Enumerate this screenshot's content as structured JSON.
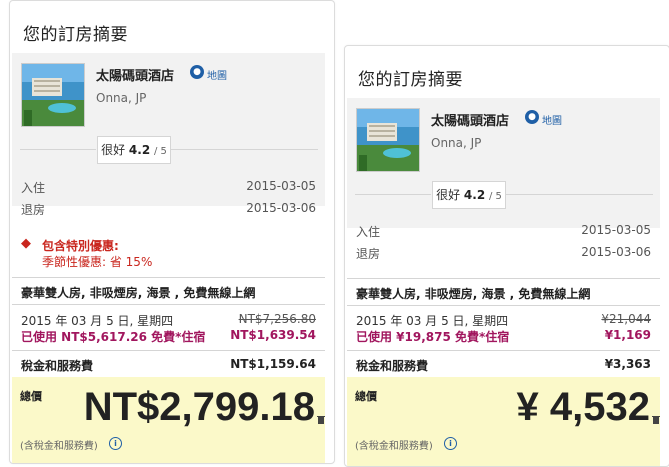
{
  "left": {
    "title": "您的訂房摘要",
    "hotel": {
      "name": "太陽碼頭酒店",
      "map_label": "地圖",
      "location": "Onna, JP",
      "rating_label": "很好",
      "rating_score": "4.2",
      "rating_denom": "/ 5"
    },
    "checkin_label": "入住",
    "checkin_value": "2015-03-05",
    "checkout_label": "退房",
    "checkout_value": "2015-03-06",
    "promo_title": "包含特別優惠:",
    "promo_detail": "季節性優惠: 省 15%",
    "room_name": "豪華雙人房, 非吸煙房, 海景 , 免費無線上網",
    "night_date": "2015 年 03 月 5 日, 星期四",
    "night_orig_price": "NT$7,256.80",
    "used_label": "已使用 NT$5,617.26 免費*住宿",
    "used_price": "NT$1,639.54",
    "tax_label": "稅金和服務費",
    "tax_value": "NT$1,159.64",
    "total_label": "總價",
    "total_amount": "NT$2,799.18",
    "total_note": "(含稅金和服務費)"
  },
  "right": {
    "title": "您的訂房摘要",
    "hotel": {
      "name": "太陽碼頭酒店",
      "map_label": "地圖",
      "location": "Onna, JP",
      "rating_label": "很好",
      "rating_score": "4.2",
      "rating_denom": "/ 5"
    },
    "checkin_label": "入住",
    "checkin_value": "2015-03-05",
    "checkout_label": "退房",
    "checkout_value": "2015-03-06",
    "room_name": "豪華雙人房, 非吸煙房, 海景 , 免費無線上網",
    "night_date": "2015 年 03 月 5 日, 星期四",
    "night_orig_price": "¥21,044",
    "used_label": "已使用 ¥19,875 免費*住宿",
    "used_price": "¥1,169",
    "tax_label": "稅金和服務費",
    "tax_value": "¥3,363",
    "total_label": "總價",
    "total_amount": "¥ 4,532",
    "total_note": "(含稅金和服務費)"
  },
  "colors": {
    "promo": "#c9261e",
    "discount": "#a1165e",
    "total_bg": "#fbf9c9",
    "link": "#1f5fa6"
  }
}
